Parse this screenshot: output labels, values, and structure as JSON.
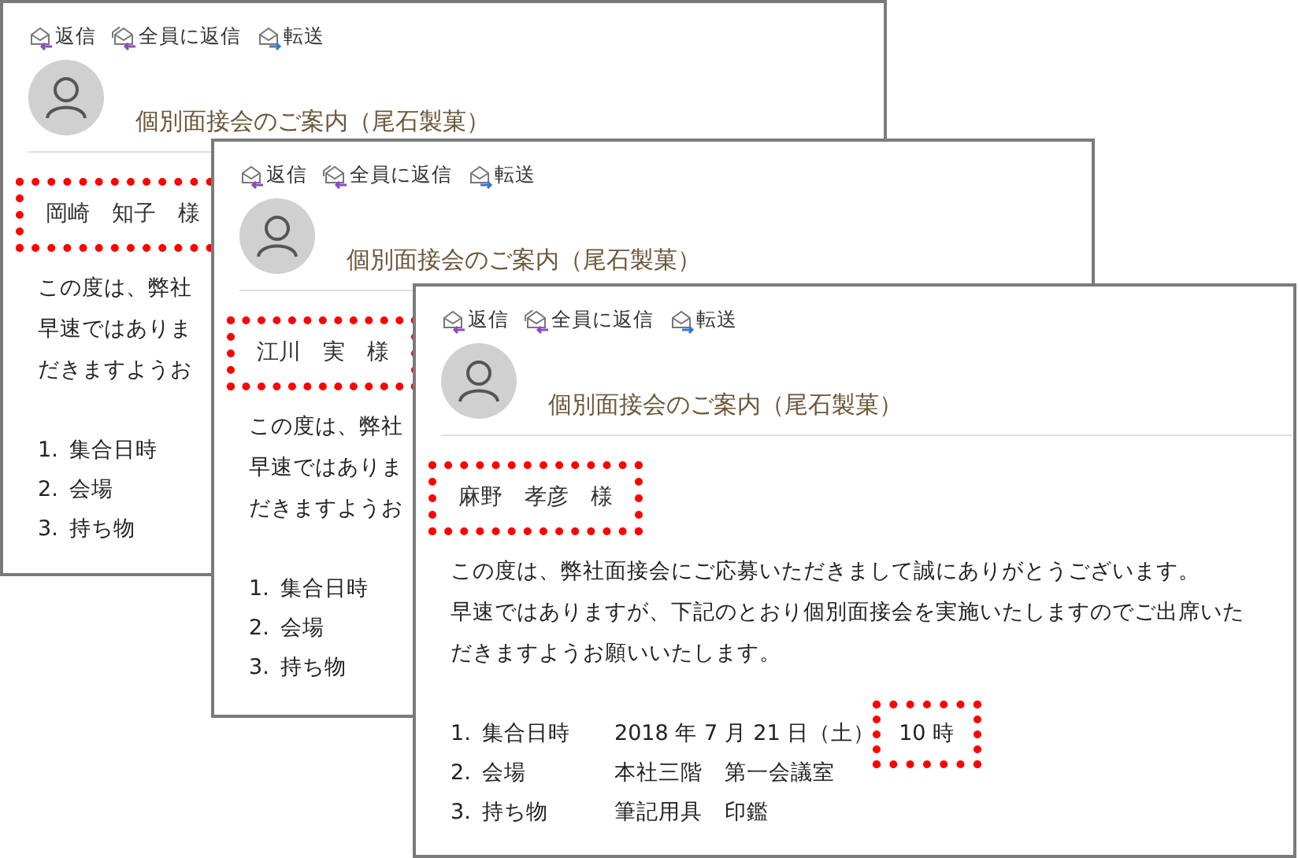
{
  "windows": [
    {
      "toolbar": [
        {
          "label": "返信",
          "kind": "reply"
        },
        {
          "label": "全員に返信",
          "kind": "reply_all"
        },
        {
          "label": "転送",
          "kind": "forward"
        }
      ],
      "subject": "個別面接会のご案内（尾石製菓）",
      "recipient": {
        "text": "岡崎　知子　様",
        "highlighted": true
      },
      "body": [
        "この度は、弊社",
        "早速ではありま",
        "だきますようお"
      ],
      "items": [
        {
          "number": "1.",
          "label": "集合日時"
        },
        {
          "number": "2.",
          "label": "会場"
        },
        {
          "number": "3.",
          "label": "持ち物"
        }
      ]
    },
    {
      "toolbar": [
        {
          "label": "返信",
          "kind": "reply"
        },
        {
          "label": "全員に返信",
          "kind": "reply_all"
        },
        {
          "label": "転送",
          "kind": "forward"
        }
      ],
      "subject": "個別面接会のご案内（尾石製菓）",
      "recipient": {
        "text": "江川　実　様",
        "highlighted": true
      },
      "body": [
        "この度は、弊社",
        "早速ではありま",
        "だきますようお"
      ],
      "items": [
        {
          "number": "1.",
          "label": "集合日時"
        },
        {
          "number": "2.",
          "label": "会場"
        },
        {
          "number": "3.",
          "label": "持ち物"
        }
      ]
    },
    {
      "toolbar": [
        {
          "label": "返信",
          "kind": "reply"
        },
        {
          "label": "全員に返信",
          "kind": "reply_all"
        },
        {
          "label": "転送",
          "kind": "forward"
        }
      ],
      "subject": "個別面接会のご案内（尾石製菓）",
      "recipient": {
        "text": "麻野　孝彦　様",
        "highlighted": true
      },
      "body": [
        "この度は、弊社面接会にご応募いただきまして誠にありがとうございます。",
        "早速ではありますが、下記のとおり個別面接会を実施いたしますのでご出席いた",
        "だきますようお願いいたします。"
      ],
      "items": [
        {
          "number": "1.",
          "label": "集合日時",
          "value": "2018 年 7 月 21 日（土）",
          "extra": {
            "text": "10 時",
            "highlighted": true
          }
        },
        {
          "number": "2.",
          "label": "会場",
          "value": "本社三階　第一会議室"
        },
        {
          "number": "3.",
          "label": "持ち物",
          "value": "筆記用具　印鑑"
        }
      ]
    }
  ]
}
